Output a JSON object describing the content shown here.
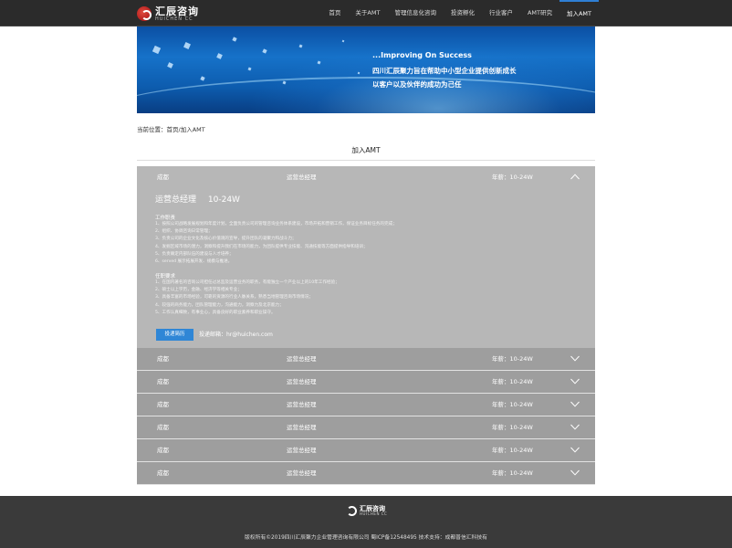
{
  "header": {
    "logo_cn": "汇辰咨询",
    "logo_en": "HUICHEN CC",
    "nav": [
      "首页",
      "关于AMT",
      "管理信息化咨询",
      "投资孵化",
      "行业客户",
      "AMT研究",
      "加入AMT"
    ],
    "active_nav": "加入AMT"
  },
  "banner": {
    "line1": "...Improving On Success",
    "line2": "四川汇辰聚力旨在帮助中小型企业提供创新成长",
    "line3": "以客户以及伙伴的成功为己任"
  },
  "breadcrumb": "当前位置：首页/加入AMT",
  "page_title": "加入AMT",
  "jobs": [
    {
      "city": "成都",
      "title": "运营总经理",
      "salary": "年薪：10-24W",
      "open": true
    },
    {
      "city": "成都",
      "title": "运营总经理",
      "salary": "年薪：10-24W",
      "open": false
    },
    {
      "city": "成都",
      "title": "运营总经理",
      "salary": "年薪：10-24W",
      "open": false
    },
    {
      "city": "成都",
      "title": "运营总经理",
      "salary": "年薪：10-24W",
      "open": false
    },
    {
      "city": "成都",
      "title": "运营总经理",
      "salary": "年薪：10-24W",
      "open": false
    },
    {
      "city": "成都",
      "title": "运营总经理",
      "salary": "年薪：10-24W",
      "open": false
    },
    {
      "city": "成都",
      "title": "运营总经理",
      "salary": "年薪：10-24W",
      "open": false
    }
  ],
  "job_detail": {
    "headline_title": "运营总经理",
    "headline_salary": "10-24W",
    "duties_label": "工作职责",
    "duties": [
      "1、按照公司战略发展规划和年度计划，全面负责公司的管理咨询业务体系建设，市场开拓和营销工作，保证业务目标任务的完成；",
      "2、组织、协调咨询日常管理；",
      "3、负责公司的企业文化及核心价值观的宣导，提升团队的凝聚力和战斗力；",
      "4、发掘区域市场的潜力，洞察和提升我们在市场的能力，为团队提供专业技能、沟通技能等方面提供指导和培训；",
      "5、负责确定内部队伍的建设与人才培养；",
      "6、served 展示拓展开发、规模与推进。"
    ],
    "reqs_label": "任职要求",
    "reqs": [
      "1、在国内著名的咨询公司担任过总监及运营业务的职务，有能独立一个产业以上的10年工作经验；",
      "2、硕士以上学历，金融、经济学等相关专业；",
      "3、具备丰富的市场经验，可靠的资源的行业人脉关系，熟悉当地管理咨询市场情况；",
      "4、较强的商务能力，团队管理能力，沟通能力，洞察力及北京能力；",
      "5、工作认真细致，有事业心，具备良好的职业素养和职业操守。"
    ],
    "apply_label": "投递简历",
    "email_label": "投递邮箱：hr@huichen.com"
  },
  "footer": {
    "logo_cn": "汇辰咨询",
    "logo_en": "HUICHEN CC",
    "copyright": "版权所有©2019四川汇辰聚力企业管理咨询有限公司  蜀ICP备12548495  技术支持：成都普信汇科技有"
  }
}
